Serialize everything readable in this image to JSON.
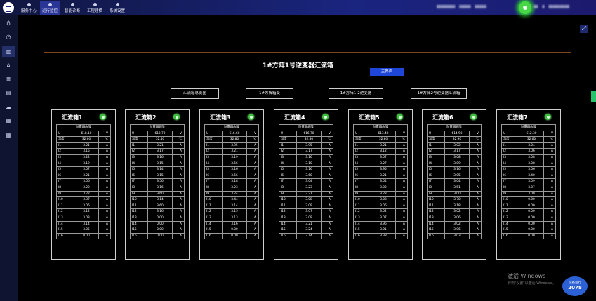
{
  "topnav": {
    "items": [
      {
        "label": "服务中心",
        "active": false
      },
      {
        "label": "运行监控",
        "active": true
      },
      {
        "label": "智能诊断",
        "active": false
      },
      {
        "label": "工程建模",
        "active": false
      },
      {
        "label": "系统设置",
        "active": false
      }
    ],
    "status_color": "#46d646"
  },
  "sidebar": {
    "icons": [
      "lightbulb-icon",
      "clock-icon",
      "chart-icon",
      "home-icon",
      "list-icon",
      "report-icon",
      "cloud-icon",
      "table-icon",
      "grid-icon"
    ],
    "active_index": 2
  },
  "page": {
    "title": "1#方阵1号逆变器汇流箱",
    "main_button": "主界面",
    "tabs": [
      "汇流箱总览图",
      "1#方阵箱变",
      "1#方阵1-2逆变器",
      "1#方阵2号逆变器汇流箱"
    ]
  },
  "boxes": [
    {
      "title": "汇流箱1",
      "header": "防雷器故障",
      "rows": [
        [
          "U",
          "618.10",
          "V"
        ],
        [
          "温度",
          "32.60",
          "℃"
        ],
        [
          "I1",
          "3.21",
          "A"
        ],
        [
          "I2",
          "3.15",
          "A"
        ],
        [
          "I3",
          "3.22",
          "A"
        ],
        [
          "I4",
          "3.19",
          "A"
        ],
        [
          "I5",
          "3.07",
          "A"
        ],
        [
          "I6",
          "3.21",
          "A"
        ],
        [
          "I7",
          "3.06",
          "A"
        ],
        [
          "I8",
          "3.20",
          "A"
        ],
        [
          "I9",
          "3.22",
          "A"
        ],
        [
          "I10",
          "3.37",
          "A"
        ],
        [
          "I11",
          "3.06",
          "A"
        ],
        [
          "I12",
          "3.12",
          "A"
        ],
        [
          "I13",
          "3.03",
          "A"
        ],
        [
          "I14",
          "3.14",
          "A"
        ],
        [
          "I15",
          "3.05",
          "A"
        ],
        [
          "I16",
          "0.00",
          "A"
        ]
      ]
    },
    {
      "title": "汇流箱2",
      "header": "防雷器故障",
      "rows": [
        [
          "U",
          "613.70",
          "V"
        ],
        [
          "温度",
          "32.40",
          "℃"
        ],
        [
          "I1",
          "3.21",
          "A"
        ],
        [
          "I2",
          "3.17",
          "A"
        ],
        [
          "I3",
          "3.16",
          "A"
        ],
        [
          "I4",
          "3.15",
          "A"
        ],
        [
          "I5",
          "3.14",
          "A"
        ],
        [
          "I6",
          "3.15",
          "A"
        ],
        [
          "I7",
          "3.56",
          "A"
        ],
        [
          "I8",
          "3.16",
          "A"
        ],
        [
          "I9",
          "3.60",
          "A"
        ],
        [
          "I10",
          "3.14",
          "A"
        ],
        [
          "I11",
          "3.60",
          "A"
        ],
        [
          "I12",
          "3.16",
          "A"
        ],
        [
          "I13",
          "0.00",
          "A"
        ],
        [
          "I14",
          "0.00",
          "A"
        ],
        [
          "I15",
          "0.00",
          "A"
        ],
        [
          "I16",
          "0.00",
          "A"
        ]
      ]
    },
    {
      "title": "汇流箱3",
      "header": "防雷器故障",
      "rows": [
        [
          "U",
          "616.60",
          "V"
        ],
        [
          "温度",
          "32.80",
          "℃"
        ],
        [
          "I1",
          "3.95",
          "A"
        ],
        [
          "I2",
          "3.21",
          "A"
        ],
        [
          "I3",
          "3.19",
          "A"
        ],
        [
          "I4",
          "3.56",
          "A"
        ],
        [
          "I5",
          "3.16",
          "A"
        ],
        [
          "I6",
          "3.56",
          "A"
        ],
        [
          "I7",
          "3.18",
          "A"
        ],
        [
          "I8",
          "3.23",
          "A"
        ],
        [
          "I9",
          "3.24",
          "A"
        ],
        [
          "I10",
          "3.44",
          "A"
        ],
        [
          "I11",
          "3.14",
          "A"
        ],
        [
          "I12",
          "3.15",
          "A"
        ],
        [
          "I13",
          "3.13",
          "A"
        ],
        [
          "I14",
          "3.16",
          "A"
        ],
        [
          "I15",
          "0.00",
          "A"
        ],
        [
          "I16",
          "0.00",
          "A"
        ]
      ]
    },
    {
      "title": "汇流箱4",
      "header": "防雷器故障",
      "rows": [
        [
          "U",
          "616.70",
          "V"
        ],
        [
          "温度",
          "32.80",
          "℃"
        ],
        [
          "I1",
          "3.95",
          "A"
        ],
        [
          "I2",
          "3.17",
          "A"
        ],
        [
          "I3",
          "3.16",
          "A"
        ],
        [
          "I4",
          "3.10",
          "A"
        ],
        [
          "I5",
          "3.16",
          "A"
        ],
        [
          "I6",
          "3.60",
          "A"
        ],
        [
          "I7",
          "3.04",
          "A"
        ],
        [
          "I8",
          "3.23",
          "A"
        ],
        [
          "I9",
          "3.21",
          "A"
        ],
        [
          "I10",
          "3.08",
          "A"
        ],
        [
          "I11",
          "3.09",
          "A"
        ],
        [
          "I12",
          "3.07",
          "A"
        ],
        [
          "I13",
          "3.08",
          "A"
        ],
        [
          "I14",
          "3.21",
          "A"
        ],
        [
          "I15",
          "3.24",
          "A"
        ],
        [
          "I16",
          "3.14",
          "A"
        ]
      ]
    },
    {
      "title": "汇流箱5",
      "header": "防雷器故障",
      "rows": [
        [
          "U",
          "613.40",
          "V"
        ],
        [
          "温度",
          "32.80",
          "℃"
        ],
        [
          "I1",
          "3.21",
          "A"
        ],
        [
          "I2",
          "3.12",
          "A"
        ],
        [
          "I3",
          "3.07",
          "A"
        ],
        [
          "I4",
          "3.27",
          "A"
        ],
        [
          "I5",
          "3.95",
          "A"
        ],
        [
          "I6",
          "3.21",
          "A"
        ],
        [
          "I7",
          "3.04",
          "A"
        ],
        [
          "I8",
          "3.02",
          "A"
        ],
        [
          "I9",
          "3.23",
          "A"
        ],
        [
          "I10",
          "3.03",
          "A"
        ],
        [
          "I11",
          "3.06",
          "A"
        ],
        [
          "I12",
          "3.02",
          "A"
        ],
        [
          "I13",
          "3.07",
          "A"
        ],
        [
          "I14",
          "3.96",
          "A"
        ],
        [
          "I15",
          "3.01",
          "A"
        ],
        [
          "I16",
          "3.38",
          "A"
        ]
      ]
    },
    {
      "title": "汇流箱6",
      "header": "防雷器故障",
      "rows": [
        [
          "U",
          "614.90",
          "V"
        ],
        [
          "温度",
          "32.90",
          "℃"
        ],
        [
          "I1",
          "3.02",
          "A"
        ],
        [
          "I2",
          "3.17",
          "A"
        ],
        [
          "I3",
          "3.08",
          "A"
        ],
        [
          "I4",
          "3.09",
          "A"
        ],
        [
          "I5",
          "3.16",
          "A"
        ],
        [
          "I6",
          "3.05",
          "A"
        ],
        [
          "I7",
          "3.04",
          "A"
        ],
        [
          "I8",
          "3.51",
          "A"
        ],
        [
          "I9",
          "3.00",
          "A"
        ],
        [
          "I10",
          "3.70",
          "A"
        ],
        [
          "I11",
          "3.18",
          "A"
        ],
        [
          "I12",
          "3.02",
          "A"
        ],
        [
          "I13",
          "3.06",
          "A"
        ],
        [
          "I14",
          "3.02",
          "A"
        ],
        [
          "I15",
          "3.06",
          "A"
        ],
        [
          "I16",
          "3.03",
          "A"
        ]
      ]
    },
    {
      "title": "汇流箱7",
      "header": "防雷器故障",
      "rows": [
        [
          "U",
          "612.30",
          "V"
        ],
        [
          "温度",
          "32.60",
          "℃"
        ],
        [
          "I1",
          "3.04",
          "A"
        ],
        [
          "I2",
          "3.06",
          "A"
        ],
        [
          "I3",
          "3.08",
          "A"
        ],
        [
          "I4",
          "3.08",
          "A"
        ],
        [
          "I5",
          "3.06",
          "A"
        ],
        [
          "I6",
          "3.40",
          "A"
        ],
        [
          "I7",
          "3.09",
          "A"
        ],
        [
          "I8",
          "3.07",
          "A"
        ],
        [
          "I9",
          "3.09",
          "A"
        ],
        [
          "I10",
          "0.00",
          "A"
        ],
        [
          "I11",
          "0.00",
          "A"
        ],
        [
          "I12",
          "0.00",
          "A"
        ],
        [
          "I13",
          "0.00",
          "A"
        ],
        [
          "I14",
          "0.00",
          "A"
        ],
        [
          "I15",
          "0.00",
          "A"
        ],
        [
          "I16",
          "0.00",
          "A"
        ]
      ]
    }
  ],
  "watermark": {
    "line1": "激活 Windows",
    "line2": "转到\"设置\"以激活 Windows。"
  },
  "badge": {
    "label": "设备运行",
    "value": "2078"
  }
}
